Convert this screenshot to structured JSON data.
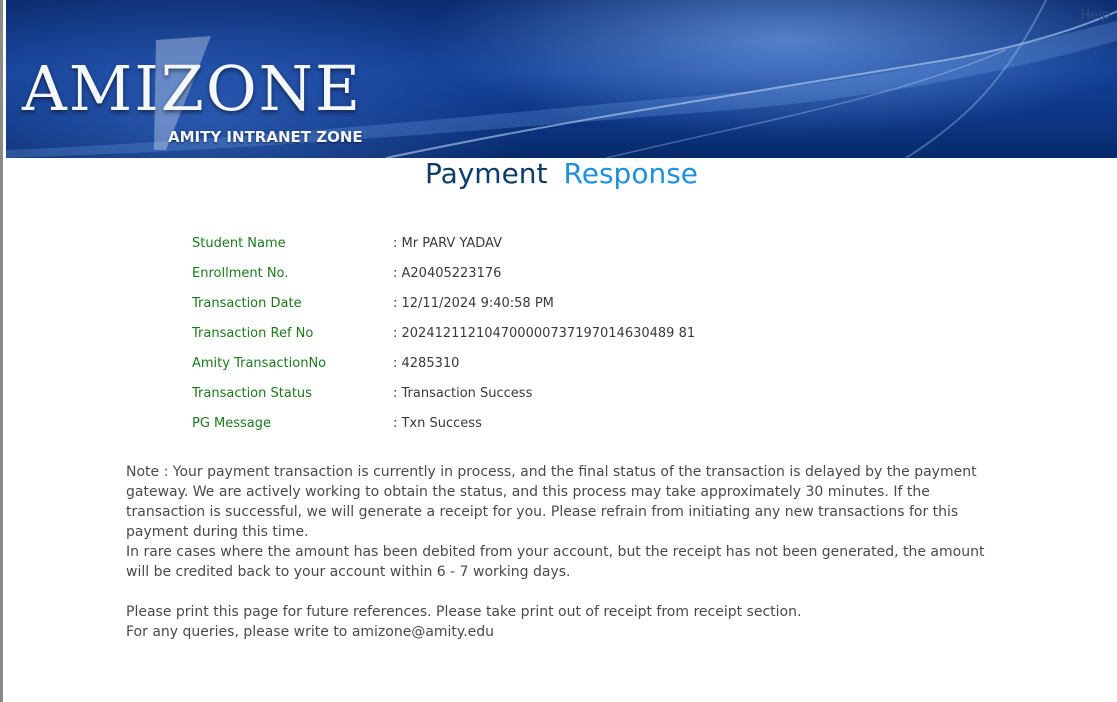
{
  "header": {
    "logo_text": "AMIZONE",
    "logo_subtitle": "AMITY INTRANET ZONE",
    "help_label": "Help"
  },
  "title": {
    "part1": "Payment",
    "part2": "Response"
  },
  "details": [
    {
      "label": "Student Name",
      "value": ": Mr PARV YADAV"
    },
    {
      "label": "Enrollment No.",
      "value": ": A20405223176"
    },
    {
      "label": "Transaction Date",
      "value": ": 12/11/2024 9:40:58 PM"
    },
    {
      "label": "Transaction Ref No",
      "value": ": 202412112104700000737197014630489 81"
    },
    {
      "label": "Amity TransactionNo",
      "value": ": 4285310"
    },
    {
      "label": "Transaction Status",
      "value": ": Transaction Success"
    },
    {
      "label": "PG Message",
      "value": ": Txn Success"
    }
  ],
  "note": {
    "line1": "Note : Your payment transaction is currently in process, and the final status of the transaction is delayed by the payment gateway. We are actively working to obtain the status, and this process may take approximately 30 minutes. If the transaction is successful, we will generate a receipt for you. Please refrain from initiating any new transactions for this payment during this time.",
    "line2": "In rare cases where the amount has been debited from your account, but the receipt has not been generated, the amount will be credited back to your account within 6 - 7 working days.",
    "line3": "Please print this page for future references. Please take print out of receipt from receipt section.",
    "line4": "For any queries, please write to amizone@amity.edu"
  },
  "colors": {
    "label_green": "#1a7a1a",
    "title_dark": "#0b3c6a",
    "title_light": "#1e90e0",
    "banner_blue": "#123f96"
  }
}
